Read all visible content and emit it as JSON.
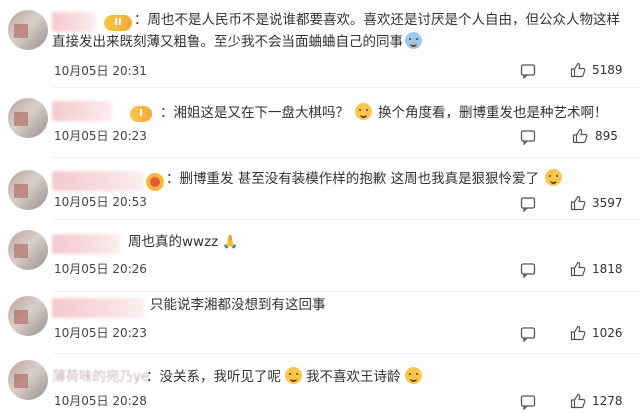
{
  "comments": [
    {
      "text_before": "：周也不是人民币不是说谁都要喜欢。喜欢还是讨厌是个人自由，但公众人物这样直接发出来既刻薄又粗鲁。至少我不会当面蛐蛐自己的同事",
      "badge": "II",
      "time": "10月05日 20:31",
      "likes": "5189"
    },
    {
      "text_before": "：湘姐这是又在下一盘大棋吗？",
      "text_after": "换个角度看，删博重发也是种艺术啊！",
      "badge": "I",
      "time": "10月05日 20:23",
      "likes": "895"
    },
    {
      "text_before": "：删博重发 甚至没有装模作样的抱歉 这周也我真是狠狠怜爱了",
      "time": "10月05日 20:53",
      "likes": "3597"
    },
    {
      "text_before": "周也真的wwzz",
      "time": "10月05日 20:26",
      "likes": "1818"
    },
    {
      "text_before": "只能说李湘都没想到有这回事",
      "time": "10月05日 20:23",
      "likes": "1026"
    },
    {
      "name_partial": "薄荷味的宛乃ye",
      "text_before": "：没关系，我听见了呢",
      "text_after": "我不喜欢王诗龄",
      "time": "10月05日 20:28",
      "likes": "1278"
    }
  ]
}
